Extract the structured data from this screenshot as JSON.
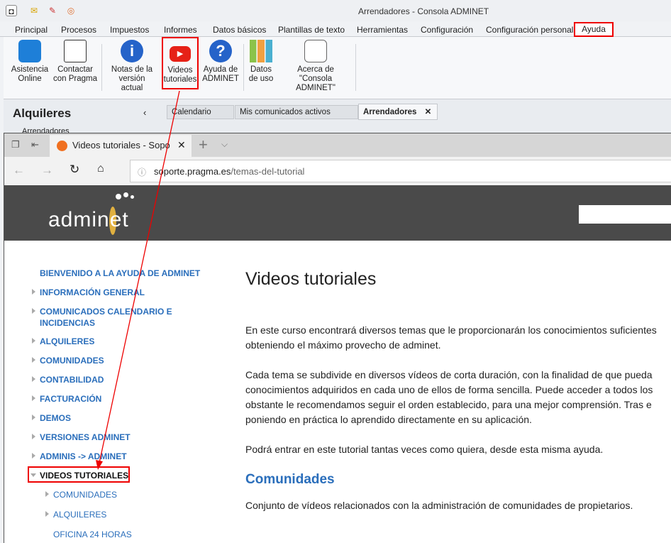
{
  "app": {
    "title": "Arrendadores - Consola ADMINET",
    "menu_tabs": [
      "Principal",
      "Procesos",
      "Impuestos",
      "Informes",
      "Datos básicos",
      "Plantillas de texto",
      "Herramientas",
      "Configuración",
      "Configuración personal",
      "Ayuda"
    ],
    "ribbon": [
      {
        "l1": "Asistencia",
        "l2": "Online"
      },
      {
        "l1": "Contactar",
        "l2": "con Pragma"
      },
      {
        "l1": "Notas de la",
        "l2": "versión actual"
      },
      {
        "l1": "Videos",
        "l2": "tutoriales"
      },
      {
        "l1": "Ayuda de",
        "l2": "ADMINET"
      },
      {
        "l1": "Datos",
        "l2": "de uso"
      },
      {
        "l1": "Acerca de",
        "l2": "\"Consola ADMINET\""
      }
    ],
    "pane_title": "Alquileres",
    "pane_item": "Arrendadores",
    "doc_tabs": [
      "Calendario",
      "Mis comunicados activos",
      "Arrendadores"
    ]
  },
  "browser": {
    "tab_title": "Videos tutoriales - Sopo",
    "url_host": "soporte.pragma.es",
    "url_path": "/temas-del-tutorial",
    "logo": "adminet"
  },
  "sidebar": [
    {
      "label": "BIENVENIDO A LA AYUDA DE ADMINET"
    },
    {
      "label": "INFORMACIÓN GENERAL"
    },
    {
      "label": "COMUNICADOS CALENDARIO E"
    },
    {
      "label": "INCIDENCIAS"
    },
    {
      "label": "ALQUILERES"
    },
    {
      "label": "COMUNIDADES"
    },
    {
      "label": "CONTABILIDAD"
    },
    {
      "label": "FACTURACIÓN"
    },
    {
      "label": "DEMOS"
    },
    {
      "label": "VERSIONES ADMINET"
    },
    {
      "label": "ADMINIS -> ADMINET"
    },
    {
      "label": "VIDEOS TUTORIALES"
    },
    {
      "label": "COMUNIDADES"
    },
    {
      "label": "ALQUILERES"
    },
    {
      "label": "OFICINA 24 HORAS"
    }
  ],
  "main": {
    "title": "Videos tutoriales",
    "p1": [
      "En este curso encontrará diversos temas que le proporcionarán los conocimientos suficientes",
      "obteniendo el máximo provecho de adminet."
    ],
    "p2": [
      "Cada tema se subdivide en diversos vídeos de corta duración, con la finalidad de que pueda",
      "conocimientos adquiridos en cada uno de ellos de forma sencilla. Puede acceder a todos los",
      "obstante le recomendamos seguir el orden establecido, para una mejor comprensión. Tras e",
      "poniendo en práctica lo aprendido directamente en su aplicación."
    ],
    "p3": "Podrá entrar en este tutorial tantas veces como quiera, desde esta misma ayuda.",
    "h2": "Comunidades",
    "p4": "Conjunto de vídeos relacionados con la administración de comunidades de propietarios."
  },
  "colors": {
    "accent": "#2a6ebb",
    "highlight": "#e00000",
    "header": "#4a4a4a"
  }
}
